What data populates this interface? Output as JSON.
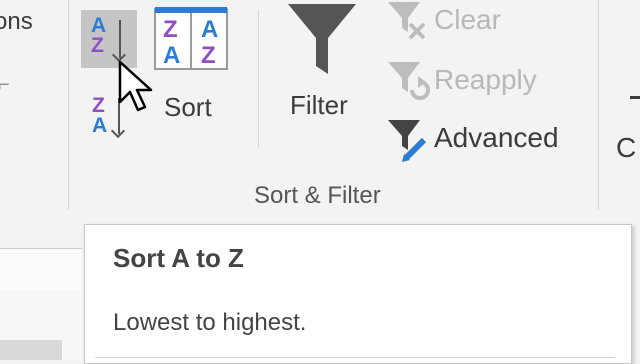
{
  "ribbon": {
    "left_partial_text": "ons",
    "sort_az": {
      "top_letter": "A",
      "bottom_letter": "Z"
    },
    "sort_za": {
      "top_letter": "Z",
      "bottom_letter": "A"
    },
    "sort_dialog": {
      "label": "Sort",
      "grid_letters": [
        "Z",
        "A",
        "A",
        "Z"
      ]
    },
    "filter": {
      "label": "Filter"
    },
    "clear": {
      "label": "Clear",
      "enabled": false
    },
    "reapply": {
      "label": "Reapply",
      "enabled": false
    },
    "advanced": {
      "label": "Advanced",
      "enabled": true
    },
    "group_label": "Sort & Filter",
    "right_partial_text": "C"
  },
  "tooltip": {
    "title": "Sort A to Z",
    "description": "Lowest to highest."
  },
  "colors": {
    "ribbon_bg": "#f3f3f3",
    "text": "#3b3b3b",
    "disabled_text": "#b8b8b8",
    "letter_blue": "#2b7cd3",
    "letter_purple": "#8e4fc4",
    "hover_bg": "#c5c5c5",
    "filter_icon": "#555555"
  }
}
